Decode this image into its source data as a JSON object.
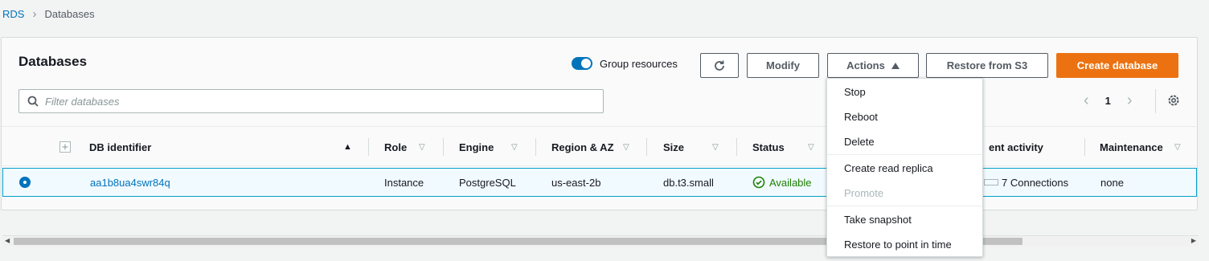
{
  "breadcrumb": {
    "root": "RDS",
    "current": "Databases"
  },
  "panel": {
    "title": "Databases",
    "group_resources_label": "Group resources",
    "buttons": {
      "modify": "Modify",
      "actions": "Actions",
      "restore_s3": "Restore from S3",
      "create": "Create database"
    },
    "search_placeholder": "Filter databases",
    "page_number": "1"
  },
  "table": {
    "columns": [
      "DB identifier",
      "Role",
      "Engine",
      "Region & AZ",
      "Size",
      "Status",
      "ent activity",
      "Maintenance"
    ],
    "rows": [
      {
        "id": "aa1b8ua4swr84q",
        "role": "Instance",
        "engine": "PostgreSQL",
        "region": "us-east-2b",
        "size": "db.t3.small",
        "status": "Available",
        "activity": "7 Connections",
        "maintenance": "none"
      }
    ]
  },
  "actions_menu": {
    "items": [
      {
        "label": "Stop",
        "disabled": false
      },
      {
        "label": "Reboot",
        "disabled": false
      },
      {
        "label": "Delete",
        "disabled": false
      },
      {
        "label": "Create read replica",
        "disabled": false
      },
      {
        "label": "Promote",
        "disabled": true
      },
      {
        "label": "Take snapshot",
        "disabled": false
      },
      {
        "label": "Restore to point in time",
        "disabled": false
      }
    ]
  },
  "colors": {
    "accent": "#0073bb",
    "primary_button": "#ec7211",
    "status_ok": "#1d8102",
    "selected_row_bg": "#f1faff"
  },
  "icons": [
    "chevron-right-icon",
    "toggle-icon",
    "refresh-icon",
    "caret-up-icon",
    "search-icon",
    "chevron-left-icon",
    "gear-icon",
    "expand-icon",
    "sort-icon",
    "radio-icon",
    "check-circle-icon"
  ]
}
